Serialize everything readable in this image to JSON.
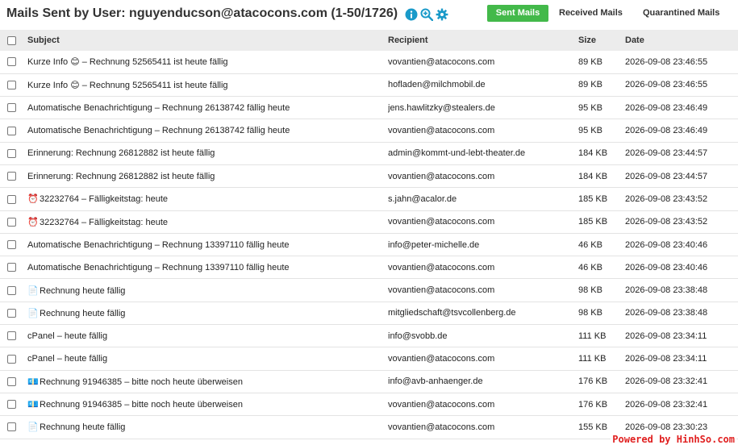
{
  "header": {
    "title": "Mails Sent by User: nguyenducson@atacocons.com (1-50/1726)",
    "icons": [
      "info-icon",
      "zoom-search-icon",
      "gear-icon"
    ],
    "tabs": {
      "sent": "Sent Mails",
      "received": "Received Mails",
      "quarantined": "Quarantined Mails"
    }
  },
  "colors": {
    "accent_green": "#43b94a",
    "icon_teal": "#1a9ac9"
  },
  "table": {
    "columns": {
      "subject": "Subject",
      "recipient": "Recipient",
      "size": "Size",
      "date": "Date"
    },
    "rows": [
      {
        "emoji": "😊",
        "subject": "Kurze Info 😊 – Rechnung 52565411 ist heute fällig",
        "recipient": "vovantien@atacocons.com",
        "size": "89 KB",
        "date": "2026-09-08 23:46:55"
      },
      {
        "emoji": "😊",
        "subject": "Kurze Info 😊 – Rechnung 52565411 ist heute fällig",
        "recipient": "hofladen@milchmobil.de",
        "size": "89 KB",
        "date": "2026-09-08 23:46:55"
      },
      {
        "emoji": "",
        "subject": "Automatische Benachrichtigung – Rechnung 26138742 fällig heute",
        "recipient": "jens.hawlitzky@stealers.de",
        "size": "95 KB",
        "date": "2026-09-08 23:46:49"
      },
      {
        "emoji": "",
        "subject": "Automatische Benachrichtigung – Rechnung 26138742 fällig heute",
        "recipient": "vovantien@atacocons.com",
        "size": "95 KB",
        "date": "2026-09-08 23:46:49"
      },
      {
        "emoji": "",
        "subject": "Erinnerung: Rechnung 26812882 ist heute fällig",
        "recipient": "admin@kommt-und-lebt-theater.de",
        "size": "184 KB",
        "date": "2026-09-08 23:44:57"
      },
      {
        "emoji": "",
        "subject": "Erinnerung: Rechnung 26812882 ist heute fällig",
        "recipient": "vovantien@atacocons.com",
        "size": "184 KB",
        "date": "2026-09-08 23:44:57"
      },
      {
        "emoji": "⏰",
        "subject": "32232764 – Fälligkeitstag: heute",
        "recipient": "s.jahn@acalor.de",
        "size": "185 KB",
        "date": "2026-09-08 23:43:52"
      },
      {
        "emoji": "⏰",
        "subject": "32232764 – Fälligkeitstag: heute",
        "recipient": "vovantien@atacocons.com",
        "size": "185 KB",
        "date": "2026-09-08 23:43:52"
      },
      {
        "emoji": "",
        "subject": "Automatische Benachrichtigung – Rechnung 13397110 fällig heute",
        "recipient": "info@peter-michelle.de",
        "size": "46 KB",
        "date": "2026-09-08 23:40:46"
      },
      {
        "emoji": "",
        "subject": "Automatische Benachrichtigung – Rechnung 13397110 fällig heute",
        "recipient": "vovantien@atacocons.com",
        "size": "46 KB",
        "date": "2026-09-08 23:40:46"
      },
      {
        "emoji": "📄",
        "subject": "Rechnung heute fällig",
        "recipient": "vovantien@atacocons.com",
        "size": "98 KB",
        "date": "2026-09-08 23:38:48"
      },
      {
        "emoji": "📄",
        "subject": "Rechnung heute fällig",
        "recipient": "mitgliedschaft@tsvcollenberg.de",
        "size": "98 KB",
        "date": "2026-09-08 23:38:48"
      },
      {
        "emoji": "",
        "subject": "cPanel – heute fällig",
        "recipient": "info@svobb.de",
        "size": "111 KB",
        "date": "2026-09-08 23:34:11"
      },
      {
        "emoji": "",
        "subject": "cPanel – heute fällig",
        "recipient": "vovantien@atacocons.com",
        "size": "111 KB",
        "date": "2026-09-08 23:34:11"
      },
      {
        "emoji": "💶",
        "subject": "Rechnung 91946385 – bitte noch heute überweisen",
        "recipient": "info@avb-anhaenger.de",
        "size": "176 KB",
        "date": "2026-09-08 23:32:41"
      },
      {
        "emoji": "💶",
        "subject": "Rechnung 91946385 – bitte noch heute überweisen",
        "recipient": "vovantien@atacocons.com",
        "size": "176 KB",
        "date": "2026-09-08 23:32:41"
      },
      {
        "emoji": "📄",
        "subject": "Rechnung heute fällig",
        "recipient": "vovantien@atacocons.com",
        "size": "155 KB",
        "date": "2026-09-08 23:30:23"
      }
    ]
  },
  "watermark": "Powered by HinhSo.com"
}
